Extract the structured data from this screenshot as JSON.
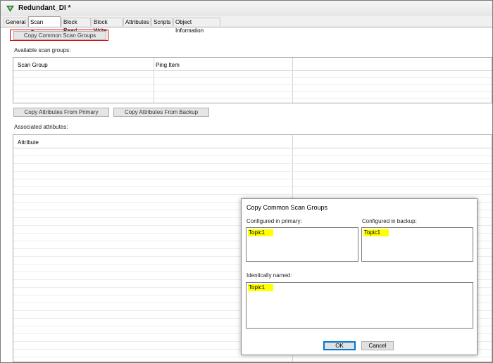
{
  "window": {
    "title": "Redundant_DI *"
  },
  "tabs": [
    {
      "label": "General"
    },
    {
      "label": "Scan Group"
    },
    {
      "label": "Block Read"
    },
    {
      "label": "Block Write"
    },
    {
      "label": "Attributes"
    },
    {
      "label": "Scripts"
    },
    {
      "label": "Object Information"
    }
  ],
  "active_tab": "Scan Group",
  "scan_group": {
    "copy_common_button": "Copy Common Scan Groups",
    "available_label": "Available scan groups:",
    "available_columns": [
      "Scan Group",
      "Ping Item"
    ],
    "copy_from_primary_button": "Copy Attributes From Primary",
    "copy_from_backup_button": "Copy Attributes From Backup",
    "associated_label": "Associated attributes:",
    "associated_columns": [
      "Attribute"
    ]
  },
  "dialog": {
    "title": "Copy Common Scan Groups",
    "primary_label": "Configured in primary:",
    "primary_items": [
      "Topic1"
    ],
    "backup_label": "Configured in backup:",
    "backup_items": [
      "Topic1"
    ],
    "identical_label": "Identically named:",
    "identical_items": [
      "Topic1"
    ],
    "ok_button": "OK",
    "cancel_button": "Cancel"
  },
  "colors": {
    "highlight_border": "#d90000",
    "item_highlight": "#ffff00",
    "default_button_border": "#0078d7"
  }
}
